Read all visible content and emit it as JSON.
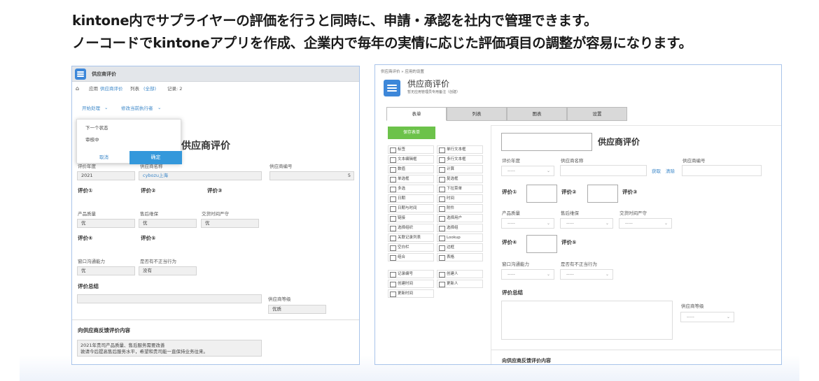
{
  "headline": {
    "line1": "kintone内でサプライヤーの評価を行うと同時に、申請・承認を社内で管理できます。",
    "line2": "ノーコードでkintoneアプリを作成、企業内で毎年の実情に応じた評価項目の調整が容易になります。"
  },
  "left": {
    "app_title": "供应商评价",
    "breadcrumb": {
      "app": "应用",
      "app_name": "供应商评价",
      "list": "列表",
      "list_all": "(全部)",
      "record": "记录: 2"
    },
    "actions": {
      "process": "开始处理",
      "change_assignee": "修改当前执行者"
    },
    "dropdown": {
      "next_status": "下一个状态",
      "status_value": "审核中",
      "cancel": "取消",
      "ok": "确定"
    },
    "form_title": "供应商评价",
    "fields": {
      "year_label": "评价年度",
      "year": "2021",
      "supplier_label": "供应商名称",
      "supplier": "cybozu上海",
      "code_label": "供应商编号",
      "code": "5",
      "eval1": "评价①",
      "eval2": "评价②",
      "eval3": "评价③",
      "quality_label": "产品质量",
      "quality": "优",
      "after_sales_label": "售后维保",
      "after_sales": "优",
      "delivery_label": "交货时间严守",
      "delivery": "优",
      "eval4": "评价④",
      "eval5": "评价⑤",
      "comm_label": "窗口沟通能力",
      "comm": "优",
      "improper_label": "是否有不正当行为",
      "improper": "没有",
      "summary": "评价总结",
      "grade_label": "供应商等级",
      "grade": "优质",
      "feedback_title": "向供应商反馈评价内容",
      "feedback_line1": "2021年贵司产品质量、售后服务需要改善",
      "feedback_line2": "敦请今后提高售后服务水平，希望和贵司能一直保持业务往来。"
    }
  },
  "right": {
    "breadcrumb": "供应商评价  »  应用的设置",
    "app_title": "供应商评价",
    "subtitle": "暂无应用管理员专用备注（创建）",
    "tabs": [
      "表单",
      "列表",
      "图表",
      "设置"
    ],
    "save_button": "保存表单",
    "palette": [
      [
        "标签",
        "单行文本框"
      ],
      [
        "文本编辑框",
        "多行文本框"
      ],
      [
        "数值",
        "计算"
      ],
      [
        "单选框",
        "复选框"
      ],
      [
        "多选",
        "下拉菜单"
      ],
      [
        "日期",
        "时间"
      ],
      [
        "日期与时间",
        "附件"
      ],
      [
        "链接",
        "选择用户"
      ],
      [
        "选择组织",
        "选择组"
      ],
      [
        "关联记录列表",
        "Lookup"
      ],
      [
        "空白栏",
        "边框"
      ],
      [
        "组合",
        "表格"
      ]
    ],
    "palette2": [
      [
        "记录编号",
        "创建人"
      ],
      [
        "创建时间",
        "更新人"
      ],
      [
        "更新时间",
        ""
      ]
    ],
    "form_title": "供应商评价",
    "fields": {
      "year_label": "评价年度",
      "supplier_label": "供应商名称",
      "get": "获取",
      "clear": "清除",
      "code_label": "供应商编号",
      "eval1": "评价①",
      "eval2": "评价②",
      "eval3": "评价③",
      "quality_label": "产品质量",
      "after_sales_label": "售后维保",
      "delivery_label": "交货时间严守",
      "eval4": "评价④",
      "eval5": "评价⑤",
      "comm_label": "窗口沟通能力",
      "improper_label": "是否有不正当行为",
      "summary": "评价总结",
      "grade_label": "供应商等级",
      "feedback_title": "向供应商反馈评价内容",
      "placeholder": "-----"
    }
  }
}
